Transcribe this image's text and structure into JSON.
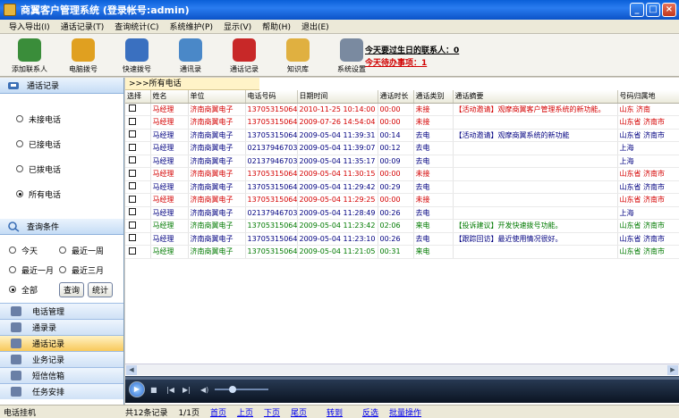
{
  "window": {
    "title": "商翼客户管理系统 (登录帐号:admin)"
  },
  "menu": [
    "导入导出(I)",
    "通话记录(T)",
    "查询统计(C)",
    "系统维护(P)",
    "显示(V)",
    "帮助(H)",
    "退出(E)"
  ],
  "toolbar": [
    {
      "label": "添加联系人",
      "icon": "add-contact-icon",
      "color": "#3a8d3a"
    },
    {
      "label": "电脑拨号",
      "icon": "phone-dial-icon",
      "color": "#e0a020"
    },
    {
      "label": "快速拨号",
      "icon": "quick-dial-icon",
      "color": "#3a70c0"
    },
    {
      "label": "通讯录",
      "icon": "address-book-icon",
      "color": "#4a88c8"
    },
    {
      "label": "通话记录",
      "icon": "call-record-icon",
      "color": "#c82828"
    },
    {
      "label": "知识库",
      "icon": "knowledge-icon",
      "color": "#e0b040"
    },
    {
      "label": "系统设置",
      "icon": "settings-icon",
      "color": "#7a8aa0"
    }
  ],
  "notices": {
    "birthday": "今天要过生日的联系人：0",
    "todo": "今天待办事项：1"
  },
  "left": {
    "call_header": "通话记录",
    "filters": [
      {
        "label": "未接电话",
        "checked": false
      },
      {
        "label": "已接电话",
        "checked": false
      },
      {
        "label": "已拨电话",
        "checked": false
      },
      {
        "label": "所有电话",
        "checked": true
      }
    ],
    "query_header": "查询条件",
    "query_options": [
      [
        {
          "label": "今天",
          "checked": false
        },
        {
          "label": "最近一周",
          "checked": false
        }
      ],
      [
        {
          "label": "最近一月",
          "checked": false
        },
        {
          "label": "最近三月",
          "checked": false
        }
      ]
    ],
    "all_label": "全部",
    "query_button": "查询",
    "stats_button": "统计",
    "nav": [
      {
        "label": "电话管理",
        "active": false
      },
      {
        "label": "通录录",
        "active": false
      },
      {
        "label": "通话记录",
        "active": true
      },
      {
        "label": "业务记录",
        "active": false
      },
      {
        "label": "短信信箱",
        "active": false
      },
      {
        "label": "任务安排",
        "active": false
      }
    ]
  },
  "main": {
    "breadcrumb": ">>>所有电话",
    "columns": [
      "选择",
      "姓名",
      "单位",
      "电话号码",
      "日期时间",
      "通话时长",
      "通话类别",
      "通话摘要",
      "号码归属地"
    ],
    "rows": [
      {
        "color": "red",
        "name": "马经理",
        "company": "济南商翼电子",
        "phone": "13705315064",
        "datetime": "2010-11-25 10:14:00",
        "duration": "00:00",
        "type": "未接",
        "summary": "【活动邀请】观摩商翼客户管理系统的新功能。",
        "summary_color": "red",
        "location": "山东 济南"
      },
      {
        "color": "red",
        "name": "马经理",
        "company": "济南商翼电子",
        "phone": "13705315064",
        "datetime": "2009-07-26 14:54:04",
        "duration": "00:00",
        "type": "未接",
        "summary": "",
        "summary_color": "",
        "location": "山东省 济南市"
      },
      {
        "color": "navy",
        "name": "马经理",
        "company": "济南商翼电子",
        "phone": "13705315064",
        "datetime": "2009-05-04 11:39:31",
        "duration": "00:14",
        "type": "去电",
        "summary": "【活动邀请】观摩商翼系统的新功能",
        "summary_color": "navy",
        "location": "山东省 济南市"
      },
      {
        "color": "navy",
        "name": "马经理",
        "company": "济南商翼电子",
        "phone": "02137946703",
        "datetime": "2009-05-04 11:39:07",
        "duration": "00:12",
        "type": "去电",
        "summary": "",
        "summary_color": "",
        "location": "上海"
      },
      {
        "color": "navy",
        "name": "马经理",
        "company": "济南商翼电子",
        "phone": "02137946703",
        "datetime": "2009-05-04 11:35:17",
        "duration": "00:09",
        "type": "去电",
        "summary": "",
        "summary_color": "",
        "location": "上海"
      },
      {
        "color": "red",
        "name": "马经理",
        "company": "济南商翼电子",
        "phone": "13705315064",
        "datetime": "2009-05-04 11:30:15",
        "duration": "00:00",
        "type": "未接",
        "summary": "",
        "summary_color": "",
        "location": "山东省 济南市"
      },
      {
        "color": "navy",
        "name": "马经理",
        "company": "济南商翼电子",
        "phone": "13705315064",
        "datetime": "2009-05-04 11:29:42",
        "duration": "00:29",
        "type": "去电",
        "summary": "",
        "summary_color": "",
        "location": "山东省 济南市"
      },
      {
        "color": "red",
        "name": "马经理",
        "company": "济南商翼电子",
        "phone": "13705315064",
        "datetime": "2009-05-04 11:29:25",
        "duration": "00:00",
        "type": "未接",
        "summary": "",
        "summary_color": "",
        "location": "山东省 济南市"
      },
      {
        "color": "navy",
        "name": "马经理",
        "company": "济南商翼电子",
        "phone": "02137946703",
        "datetime": "2009-05-04 11:28:49",
        "duration": "00:26",
        "type": "去电",
        "summary": "",
        "summary_color": "",
        "location": "上海"
      },
      {
        "color": "green",
        "name": "马经理",
        "company": "济南商翼电子",
        "phone": "13705315064",
        "datetime": "2009-05-04 11:23:42",
        "duration": "02:06",
        "type": "来电",
        "summary": "【投诉建议】开发快速拨号功能。",
        "summary_color": "green",
        "location": "山东省 济南市"
      },
      {
        "color": "navy",
        "name": "马经理",
        "company": "济南商翼电子",
        "phone": "13705315064",
        "datetime": "2009-05-04 11:23:10",
        "duration": "00:26",
        "type": "去电",
        "summary": "【跟踪回访】最近使用情况很好。",
        "summary_color": "navy",
        "location": "山东省 济南市"
      },
      {
        "color": "green",
        "name": "马经理",
        "company": "济南商翼电子",
        "phone": "13705315064",
        "datetime": "2009-05-04 11:21:05",
        "duration": "00:31",
        "type": "来电",
        "summary": "",
        "summary_color": "",
        "location": "山东省 济南市"
      }
    ]
  },
  "status": {
    "left": "电话挂机",
    "total": "共12条记录",
    "page": "1/1页",
    "links": [
      "首页",
      "上页",
      "下页",
      "尾页",
      "转到",
      "反选",
      "批量操作"
    ]
  }
}
